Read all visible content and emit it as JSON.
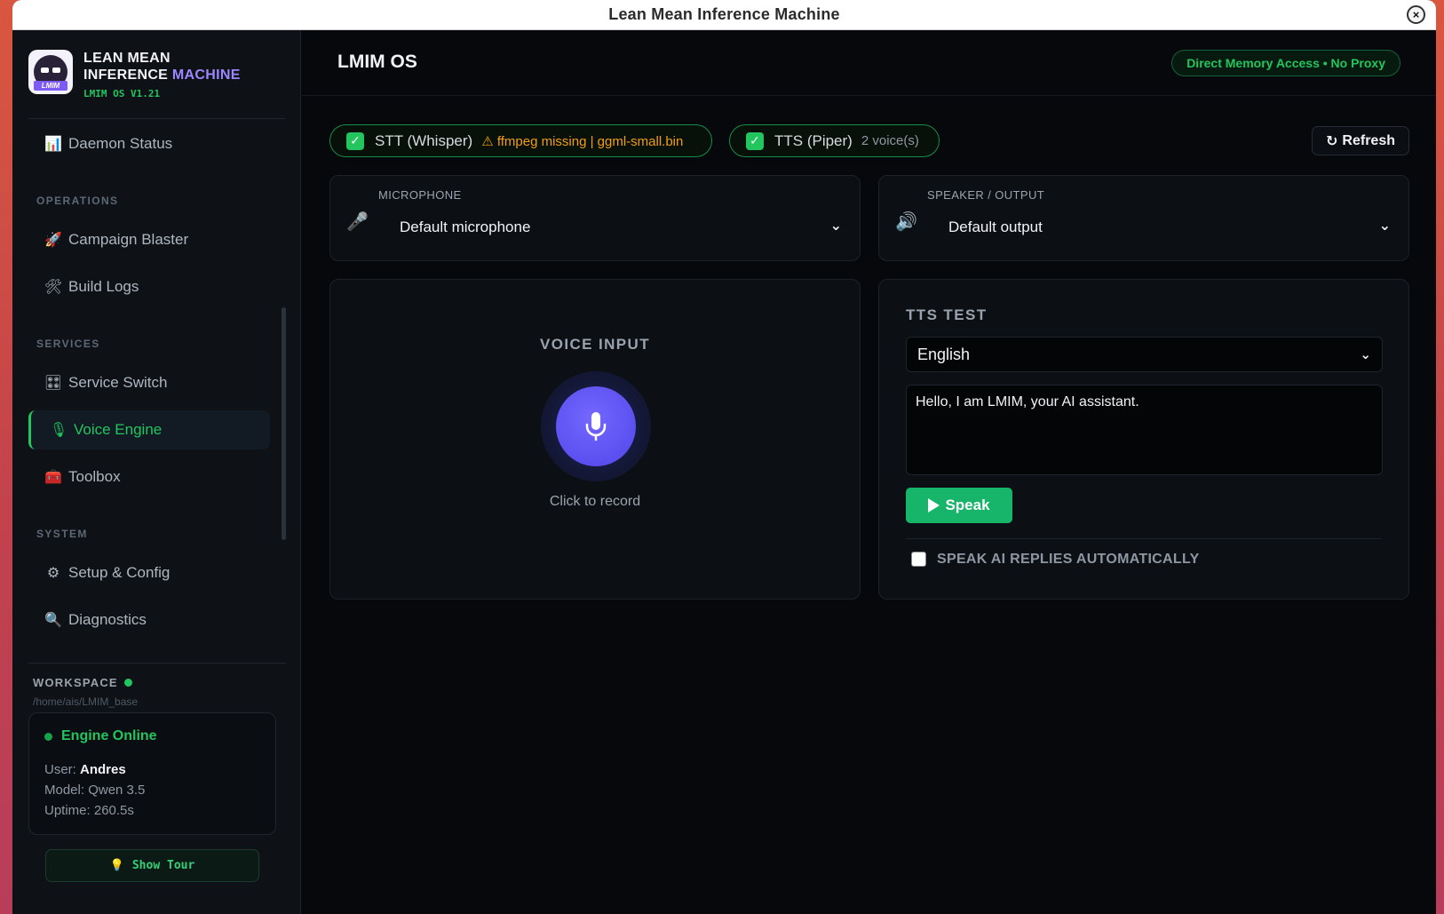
{
  "window": {
    "title": "Lean Mean Inference Machine",
    "close_glyph": "×"
  },
  "brand": {
    "logo_text": "LMIM",
    "line1": "LEAN MEAN",
    "line2_main": "INFERENCE",
    "line2_accent": "MACHINE",
    "version": "LMIM OS V1.21"
  },
  "sidebar": {
    "partial_item": {
      "label": "Daemon Status",
      "icon": "chart-icon"
    },
    "sections": [
      {
        "title": "OPERATIONS",
        "items": [
          {
            "label": "Campaign Blaster",
            "icon": "rocket-icon",
            "glyph": "🚀"
          },
          {
            "label": "Build Logs",
            "icon": "tools-icon",
            "glyph": "🛠"
          }
        ]
      },
      {
        "title": "SERVICES",
        "items": [
          {
            "label": "Service Switch",
            "icon": "switch-icon",
            "glyph": "🎛"
          },
          {
            "label": "Voice Engine",
            "icon": "mic-icon",
            "glyph": "🎙",
            "active": true
          },
          {
            "label": "Toolbox",
            "icon": "toolbox-icon",
            "glyph": "🧰"
          }
        ]
      },
      {
        "title": "SYSTEM",
        "items": [
          {
            "label": "Setup & Config",
            "icon": "gear-icon",
            "glyph": "⚙"
          },
          {
            "label": "Diagnostics",
            "icon": "magnifier-icon",
            "glyph": "🔍"
          }
        ]
      }
    ],
    "workspace": {
      "label": "WORKSPACE",
      "path": "/home/ais/LMIM_base",
      "status": "Engine Online",
      "user_label": "User:",
      "user": "Andres",
      "model": "Model: Qwen 3.5",
      "uptime": "Uptime: 260.5s"
    },
    "tour_button": {
      "label": "Show Tour",
      "icon": "lightbulb-icon"
    }
  },
  "header": {
    "title": "LMIM OS",
    "badge": "Direct Memory Access • No Proxy"
  },
  "status": {
    "stt": {
      "label": "STT (Whisper)",
      "warning": "ffmpeg missing | ggml-small.bin"
    },
    "tts": {
      "label": "TTS (Piper)",
      "detail": "2 voice(s)"
    },
    "refresh_label": "Refresh"
  },
  "devices": {
    "microphone": {
      "label": "MICROPHONE",
      "value": "Default microphone",
      "icon": "microphone-icon"
    },
    "speaker": {
      "label": "SPEAKER / OUTPUT",
      "value": "Default output",
      "icon": "speaker-icon"
    }
  },
  "voice_input": {
    "title": "VOICE INPUT",
    "caption": "Click to record"
  },
  "tts_test": {
    "title": "TTS TEST",
    "language": "English",
    "text": "Hello, I am LMIM, your AI assistant.",
    "speak_label": "Speak",
    "auto_label": "SPEAK AI REPLIES AUTOMATICALLY",
    "auto_checked": false
  },
  "colors": {
    "accent_green": "#22c55e",
    "accent_purple": "#9b86ff",
    "mic_button": "#5b4ff0",
    "warning": "#f59e0b",
    "speak_button": "#16b56a"
  }
}
